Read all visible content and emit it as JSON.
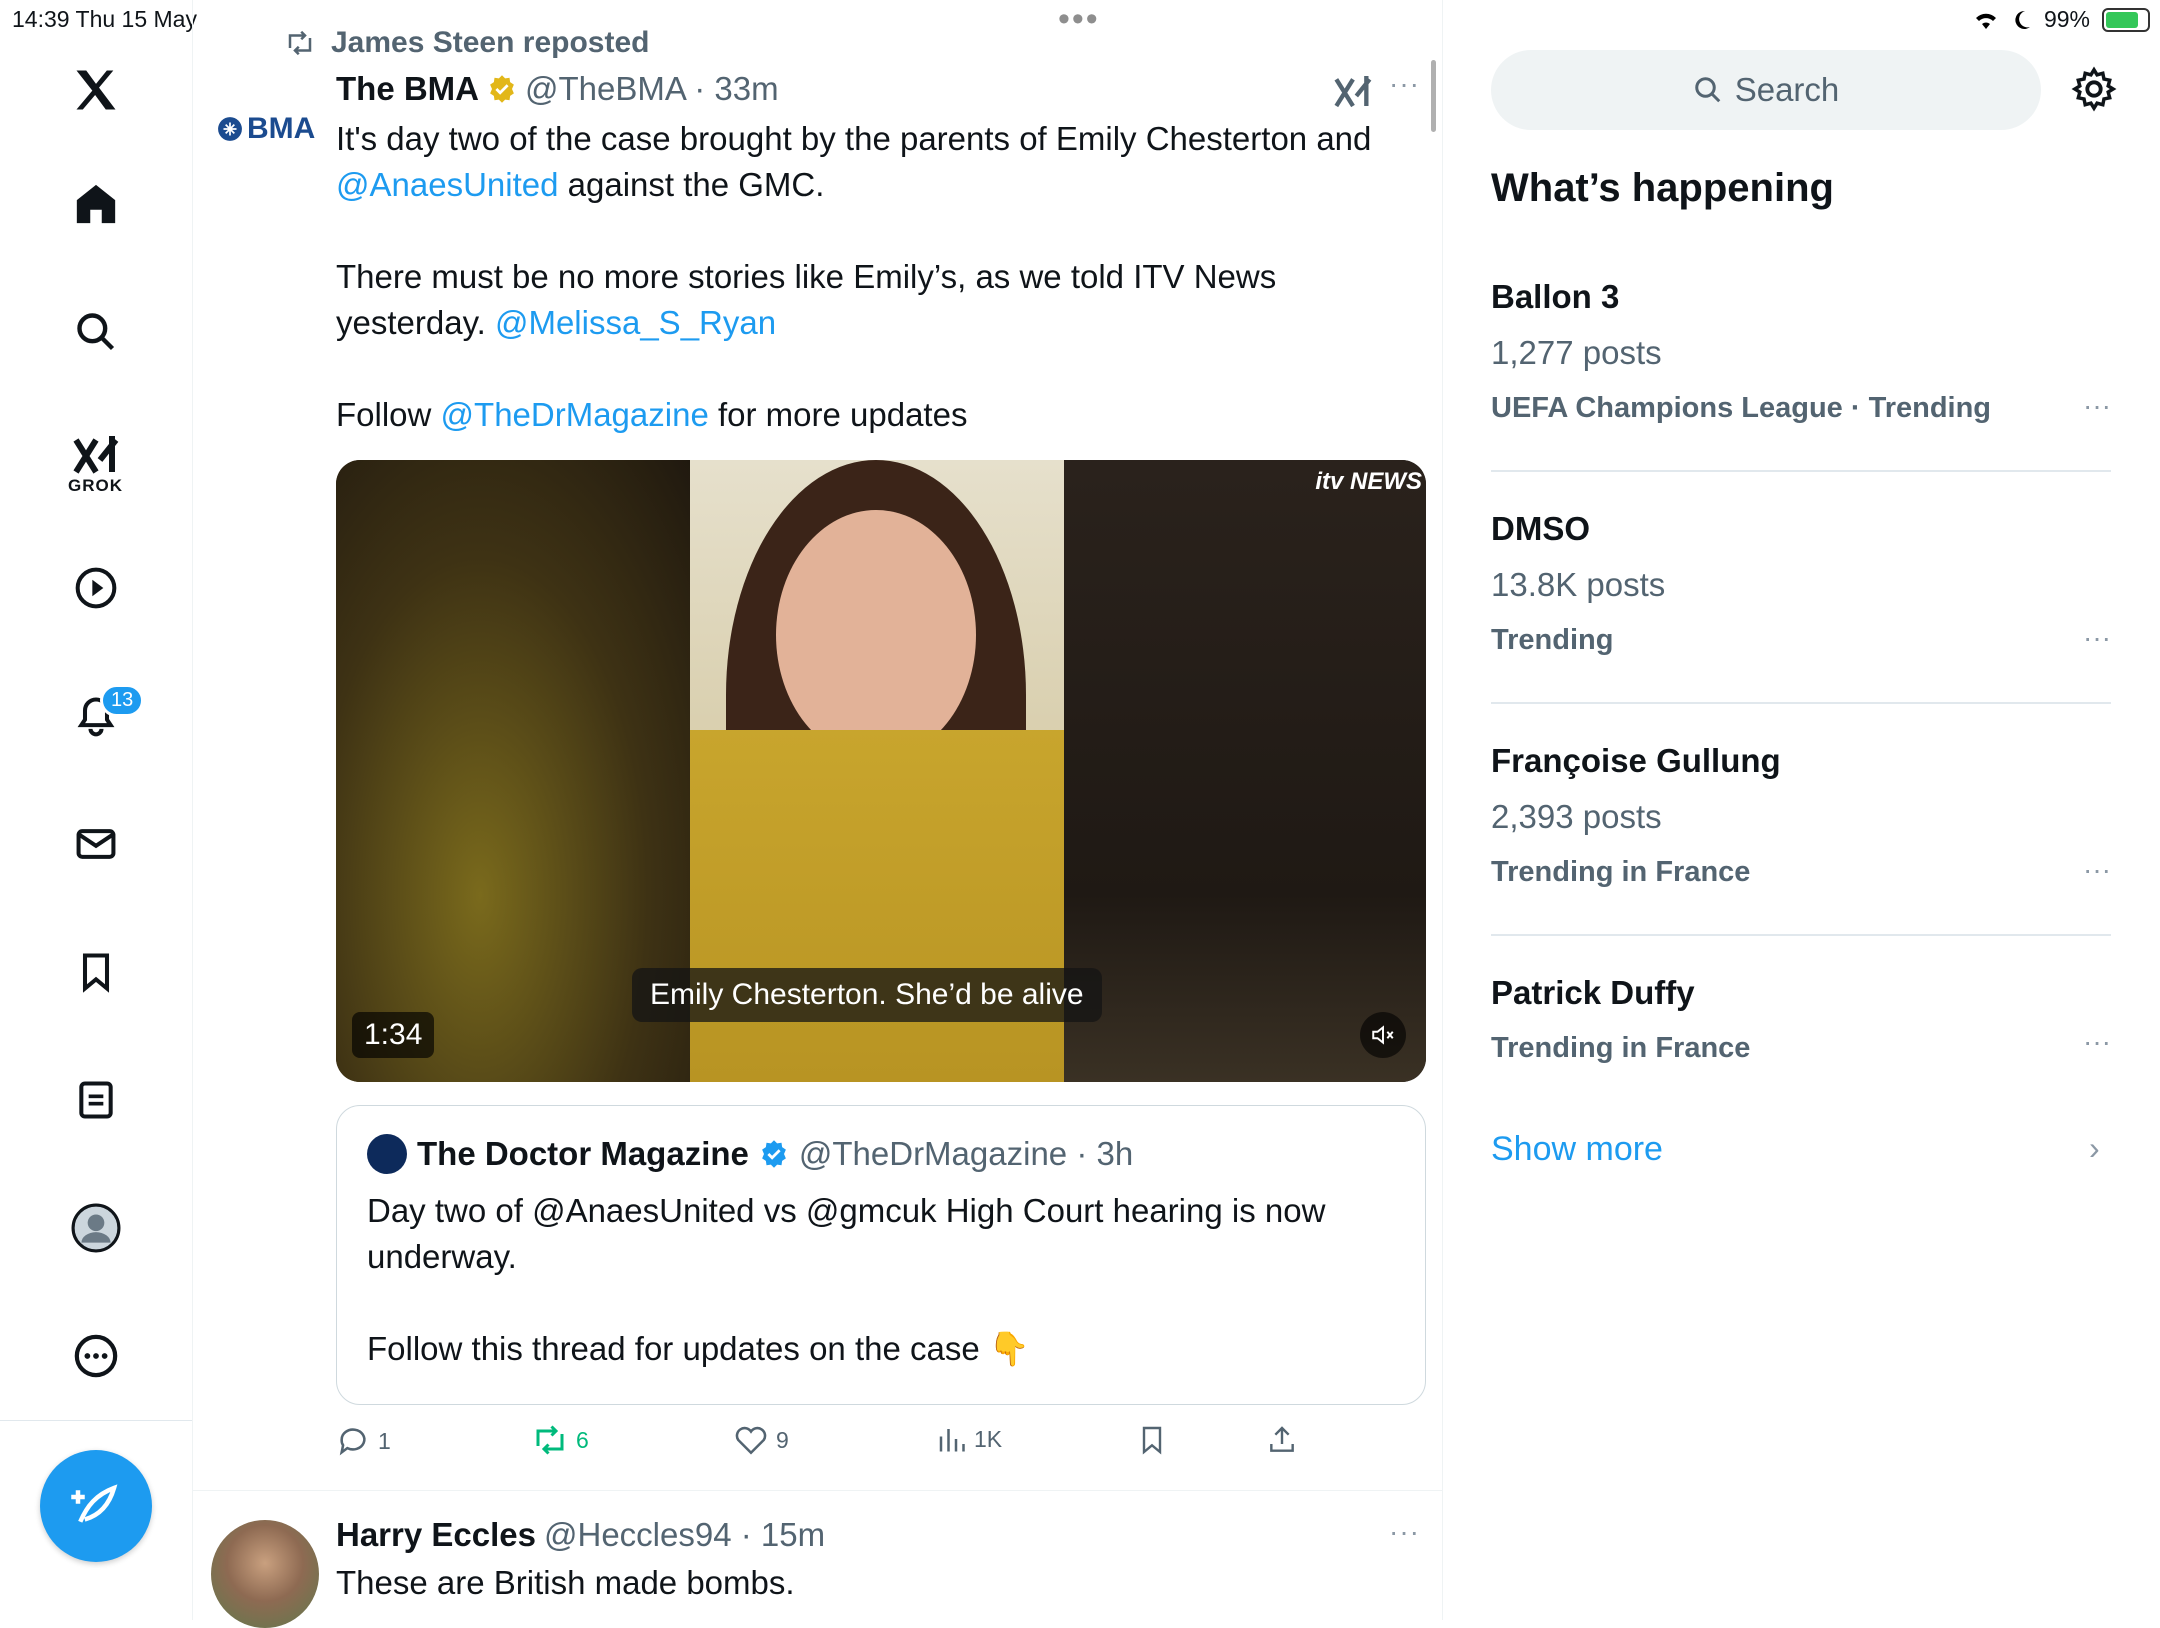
{
  "status": {
    "time_date": "14:39  Thu 15 May",
    "battery": "99%"
  },
  "nav": {
    "grok_label": "GROK",
    "notifications_badge": "13",
    "icons": [
      "x-logo-icon",
      "home-icon",
      "search-icon",
      "grok-icon",
      "video-icon",
      "bell-icon",
      "mail-icon",
      "bookmark-icon",
      "list-icon",
      "profile-icon",
      "more-icon",
      "compose-icon"
    ]
  },
  "tweet": {
    "repost_label": "James Steen reposted",
    "avatar_text": "BMA",
    "name": "The BMA",
    "handle_time": "@TheBMA · 33m",
    "text_l1a": "It's day two of the case brought by the parents of Emily Chesterton and",
    "mention1": "@AnaesUnited",
    "text_l1b": " against the GMC.",
    "text_l2a": "There must be no more stories like Emily’s, as we told ITV News yesterday. ",
    "mention2": "@Melissa_S_Ryan",
    "text_l3a": "Follow ",
    "mention3": "@TheDrMagazine",
    "text_l3b": " for more updates",
    "video": {
      "channel": "itv NEWS",
      "caption": "Emily Chesterton. She’d be alive",
      "duration": "1:34"
    },
    "quote": {
      "name": "The Doctor Magazine",
      "handle_time": "@TheDrMagazine · 3h",
      "text1": "Day two of @AnaesUnited vs @gmcuk High Court hearing is now underway.",
      "text2": "Follow this thread for updates on the case 👇"
    },
    "actions": {
      "replies": "1",
      "reposts": "6",
      "likes": "9",
      "views": "1K"
    }
  },
  "next_tweet": {
    "name": "Harry Eccles",
    "handle_time": "@Heccles94 · 15m",
    "text": "These are British made bombs."
  },
  "sidebar": {
    "search_placeholder": "Search",
    "heading": "What’s happening",
    "trends": [
      {
        "name": "Ballon 3",
        "posts": "1,277 posts",
        "category": "UEFA Champions League · Trending"
      },
      {
        "name": "DMSO",
        "posts": "13.8K posts",
        "category": "Trending"
      },
      {
        "name": "Françoise Gullung",
        "posts": "2,393 posts",
        "category": "Trending in France"
      },
      {
        "name": "Patrick Duffy",
        "posts": "",
        "category": "Trending in France"
      }
    ],
    "show_more": "Show more"
  },
  "colors": {
    "accent": "#1d9bf0",
    "repost_green": "#00ba7c",
    "muted": "#536471"
  }
}
